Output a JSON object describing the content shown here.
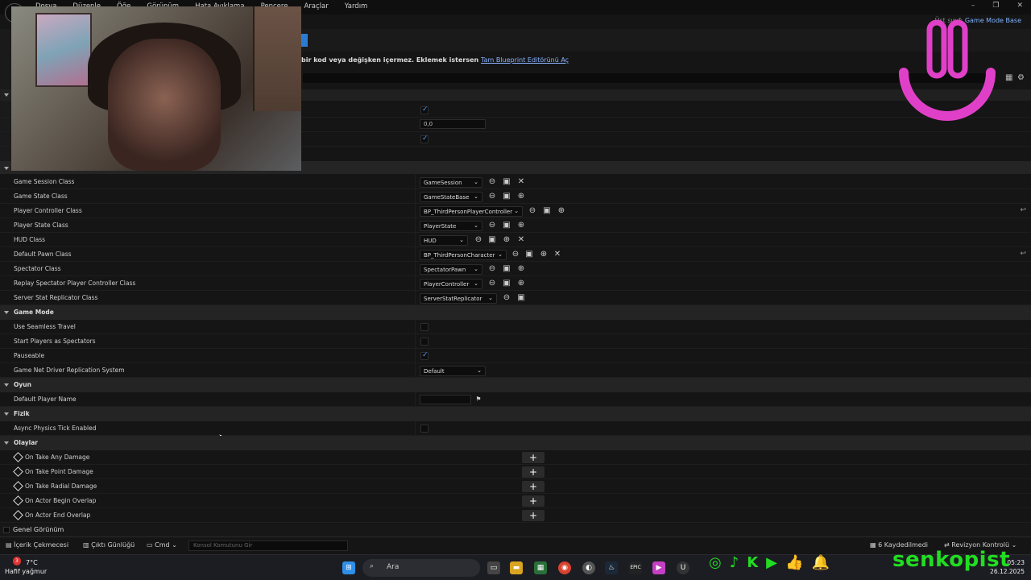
{
  "menu": [
    "Dosya",
    "Düzenle",
    "Öğe",
    "Görünüm",
    "Hata Ayıklama",
    "Pencere",
    "Araçlar",
    "Yardım"
  ],
  "window_controls": [
    "–",
    "❐",
    "✕"
  ],
  "parent_class": {
    "label": "Üst sınıf:",
    "value": "Game Mode Base"
  },
  "notice": {
    "text": "bir kod veya değişken içermez. Eklemek istersen",
    "link": "Tam Blueprint Editörünü Aç"
  },
  "top_values": {
    "number": "0,0"
  },
  "classes": {
    "rows": [
      {
        "label": "Game Session Class",
        "value": "GameSession"
      },
      {
        "label": "Game State Class",
        "value": "GameStateBase"
      },
      {
        "label": "Player Controller Class",
        "value": "BP_ThirdPersonPlayerController"
      },
      {
        "label": "Player State Class",
        "value": "PlayerState"
      },
      {
        "label": "HUD Class",
        "value": "HUD"
      },
      {
        "label": "Default Pawn Class",
        "value": "BP_ThirdPersonCharacter"
      },
      {
        "label": "Spectator Class",
        "value": "SpectatorPawn"
      },
      {
        "label": "Replay Spectator Player Controller Class",
        "value": "PlayerController"
      },
      {
        "label": "Server Stat Replicator Class",
        "value": "ServerStatReplicator"
      }
    ]
  },
  "game_mode": {
    "title": "Game Mode",
    "rows": [
      {
        "label": "Use Seamless Travel",
        "checked": false
      },
      {
        "label": "Start Players as Spectators",
        "checked": false
      },
      {
        "label": "Pauseable",
        "checked": true
      }
    ],
    "replication": {
      "label": "Game Net Driver Replication System",
      "value": "Default"
    }
  },
  "oyun": {
    "title": "Oyun",
    "row": "Default Player Name"
  },
  "fizik": {
    "title": "Fizik",
    "row": "Async Physics Tick Enabled"
  },
  "olaylar": {
    "title": "Olaylar",
    "events": [
      "On Take Any Damage",
      "On Take Point Damage",
      "On Take Radial Damage",
      "On Actor Begin Overlap",
      "On Actor End Overlap"
    ]
  },
  "genel": "Genel Görünüm",
  "bottom": {
    "content_drawer": "İçerik Çekmecesi",
    "output_log": "Çıktı Günlüğü",
    "cmd": "Cmd",
    "console_placeholder": "Konsol Komutunu Gir",
    "saved": "6 Kaydedilmedi",
    "revision": "Revizyon Kontrolü"
  },
  "taskbar": {
    "temp": "7°C",
    "weather": "Hafif yağmur",
    "search": "Ara",
    "time": "05:23",
    "date": "26.12.2025",
    "badge": "3"
  },
  "overlay": {
    "brand": "senkopist",
    "accent": "#22dd22",
    "logo_color": "#e040c8"
  }
}
